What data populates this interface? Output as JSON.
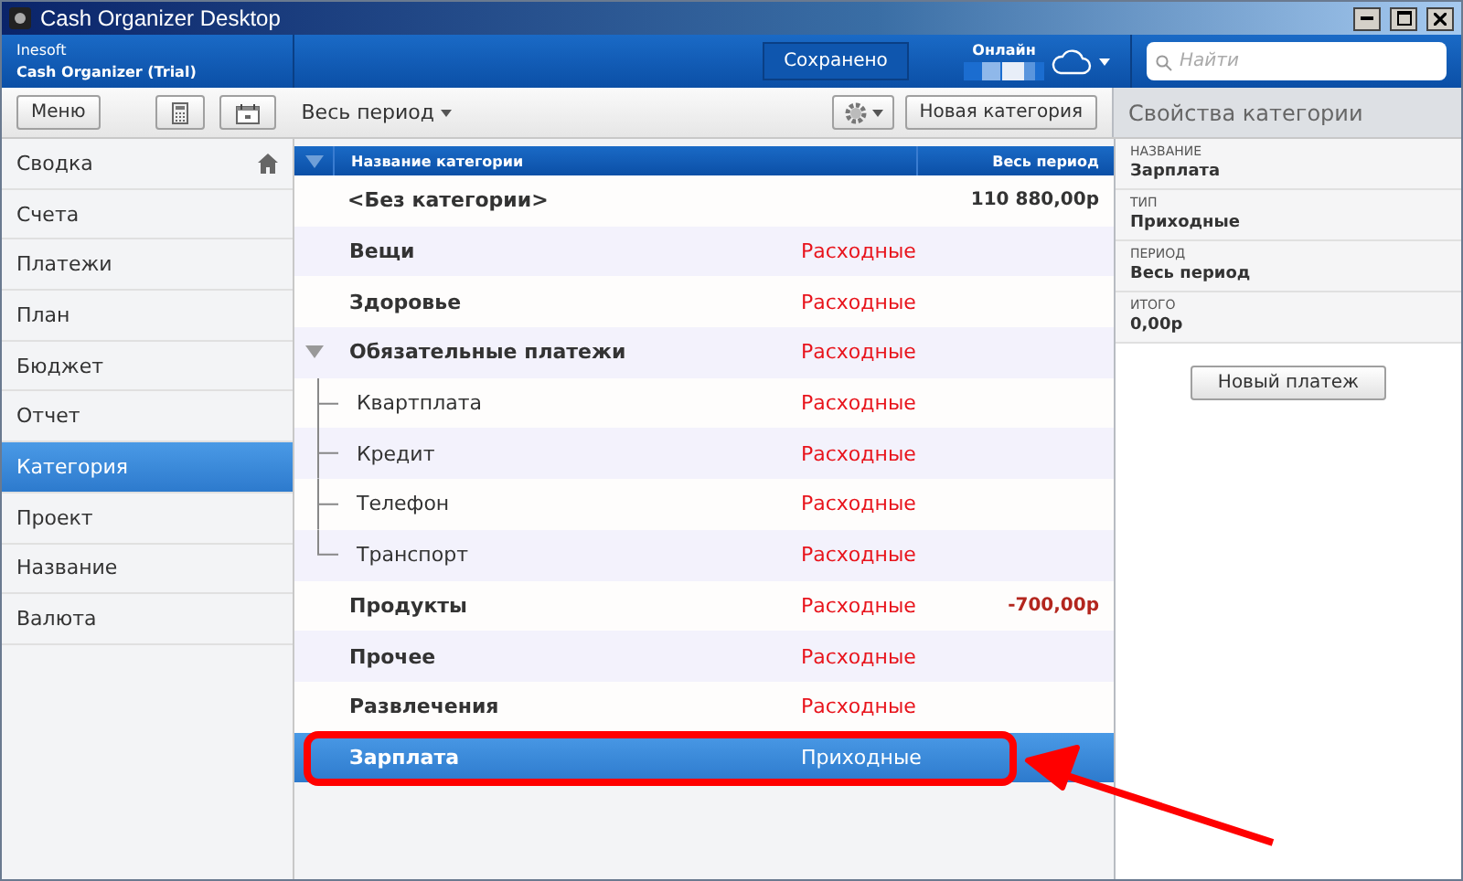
{
  "window": {
    "title": "Cash Organizer Desktop"
  },
  "header": {
    "company": "Inesoft",
    "product": "Cash Organizer (Trial)",
    "save_status": "Сохранено",
    "sync_label": "Онлайн",
    "search": {
      "placeholder": "Найти"
    }
  },
  "toolbar": {
    "menu_button": "Меню",
    "period": "Весь период",
    "new_category_button": "Новая категория"
  },
  "sidebar": {
    "items": [
      {
        "label": "Сводка",
        "selected": false
      },
      {
        "label": "Счета",
        "selected": false
      },
      {
        "label": "Платежи",
        "selected": false
      },
      {
        "label": "План",
        "selected": false
      },
      {
        "label": "Бюджет",
        "selected": false
      },
      {
        "label": "Отчет",
        "selected": false
      },
      {
        "label": "Категория",
        "selected": true
      },
      {
        "label": "Проект",
        "selected": false
      },
      {
        "label": "Название",
        "selected": false
      },
      {
        "label": "Валюта",
        "selected": false
      }
    ]
  },
  "table": {
    "columns": [
      "Название категории",
      "Весь период"
    ],
    "rows": [
      {
        "name": "<Без категории>",
        "selected": false,
        "amount": {
          "text": "110 880,00р",
          "color": "#333333"
        }
      },
      {
        "name": "Вещи",
        "type": "Расходные",
        "selected": false
      },
      {
        "name": "Здоровье",
        "type": "Расходные",
        "selected": false
      },
      {
        "name": "Обязательные платежи",
        "type": "Расходные",
        "selected": false,
        "expanded": true,
        "children": [
          {
            "name": "Квартплата",
            "type": "Расходные",
            "selected": false
          },
          {
            "name": "Кредит",
            "type": "Расходные",
            "selected": false
          },
          {
            "name": "Телефон",
            "type": "Расходные",
            "selected": false
          },
          {
            "name": "Транспорт",
            "type": "Расходные",
            "selected": false
          }
        ]
      },
      {
        "name": "Продукты",
        "type": "Расходные",
        "selected": false,
        "amount": {
          "text": "-700,00р",
          "color": "#b3261e"
        }
      },
      {
        "name": "Прочее",
        "type": "Расходные",
        "selected": false
      },
      {
        "name": "Развлечения",
        "type": "Расходные",
        "selected": false
      },
      {
        "name": "Зарплата",
        "type": "Приходные",
        "selected": true
      }
    ]
  },
  "properties": {
    "title": "Свойства категории",
    "fields": [
      {
        "label": "НАЗВАНИЕ",
        "value": "Зарплата"
      },
      {
        "label": "ТИП",
        "value": "Приходные"
      },
      {
        "label": "ПЕРИОД",
        "value": "Весь период"
      },
      {
        "label": "ИТОГО",
        "value": "0,00р"
      }
    ],
    "button": "Новый платеж"
  }
}
